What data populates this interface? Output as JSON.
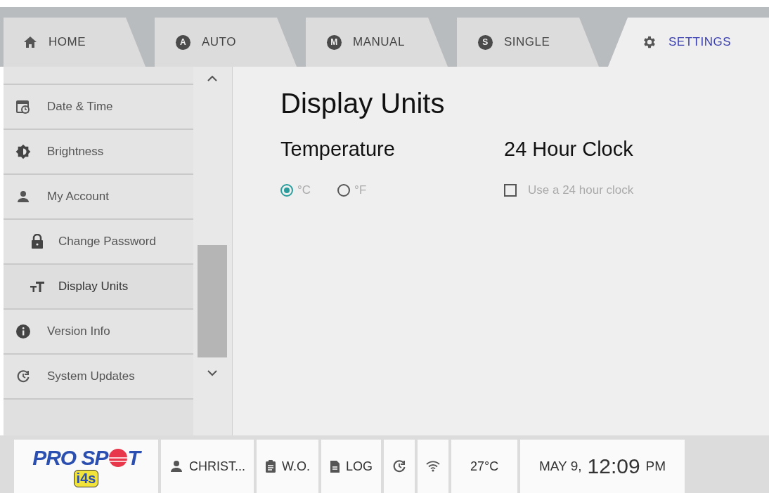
{
  "tabs": [
    {
      "label": "HOME",
      "selected": false
    },
    {
      "label": "AUTO",
      "letter": "A",
      "selected": false
    },
    {
      "label": "MANUAL",
      "letter": "M",
      "selected": false
    },
    {
      "label": "SINGLE",
      "letter": "S",
      "selected": false
    },
    {
      "label": "SETTINGS",
      "selected": true
    }
  ],
  "sidebar": {
    "items": [
      {
        "label": "Date & Time",
        "sub": false,
        "selected": false
      },
      {
        "label": "Brightness",
        "sub": false,
        "selected": false
      },
      {
        "label": "My Account",
        "sub": false,
        "selected": false
      },
      {
        "label": "Change Password",
        "sub": true,
        "selected": false
      },
      {
        "label": "Display Units",
        "sub": true,
        "selected": true
      },
      {
        "label": "Version Info",
        "sub": false,
        "selected": false
      },
      {
        "label": "System Updates",
        "sub": false,
        "selected": false
      }
    ]
  },
  "content": {
    "title": "Display Units",
    "temperature": {
      "heading": "Temperature",
      "options": [
        {
          "label": "°C",
          "selected": true
        },
        {
          "label": "°F",
          "selected": false
        }
      ]
    },
    "clock": {
      "heading": "24 Hour Clock",
      "checkbox": {
        "label": "Use a 24 hour clock",
        "checked": false
      }
    }
  },
  "status_bar": {
    "logo": {
      "text_before": "PRO SP",
      "text_after": "T",
      "badge": "i4s"
    },
    "items": [
      {
        "kind": "user",
        "label": "CHRIST..."
      },
      {
        "kind": "clipboard",
        "label": "W.O."
      },
      {
        "kind": "document",
        "label": "LOG"
      },
      {
        "kind": "update"
      },
      {
        "kind": "wifi"
      },
      {
        "kind": "text",
        "label": "27°C"
      }
    ],
    "date": "MAY 9,",
    "time": "12:09",
    "ampm": "PM"
  }
}
